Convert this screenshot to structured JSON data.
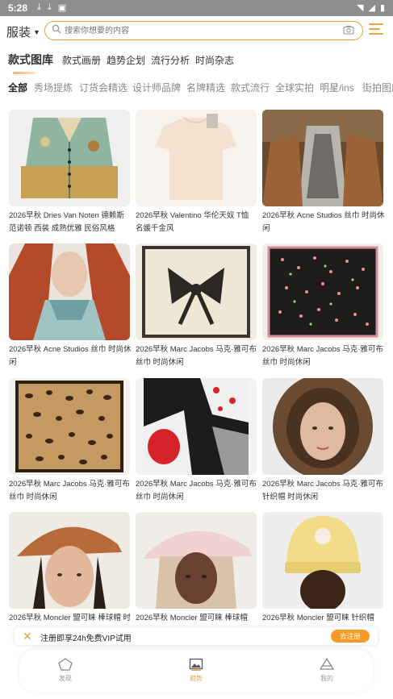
{
  "status_bar": {
    "time": "5:28"
  },
  "search": {
    "category": "服装",
    "placeholder": "搜索你想要的内容"
  },
  "top_tabs": [
    {
      "label": "款式图库",
      "active": true
    },
    {
      "label": "款式画册",
      "active": false
    },
    {
      "label": "趋势企划",
      "active": false
    },
    {
      "label": "流行分析",
      "active": false
    },
    {
      "label": "时尚杂志",
      "active": false
    }
  ],
  "filter_tabs": [
    {
      "label": "全部",
      "active": true
    },
    {
      "label": "秀场提炼"
    },
    {
      "label": "订货会精选"
    },
    {
      "label": "设计师品牌"
    },
    {
      "label": "名牌精选"
    },
    {
      "label": "款式流行"
    },
    {
      "label": "全球实拍"
    },
    {
      "label": "明星/ins"
    },
    {
      "label": "街拍图库"
    }
  ],
  "cards": [
    {
      "caption": "2026早秋 Dries Van Noten 德赖斯范诺顿 西装 成熟优雅 民俗风格"
    },
    {
      "caption": "2026早秋 Valentino 华伦天奴 T恤 名媛千金风"
    },
    {
      "caption": "2026早秋 Acne Studios 丝巾 时尚休闲"
    },
    {
      "caption": "2026早秋 Acne Studios 丝巾 时尚休闲"
    },
    {
      "caption": "2026早秋 Marc Jacobs 马克·雅可布 丝巾 时尚休闲"
    },
    {
      "caption": "2026早秋 Marc Jacobs 马克·雅可布 丝巾 时尚休闲"
    },
    {
      "caption": "2026早秋 Marc Jacobs 马克·雅可布 丝巾 时尚休闲"
    },
    {
      "caption": "2026早秋 Marc Jacobs 马克·雅可布 丝巾 时尚休闲"
    },
    {
      "caption": "2026早秋 Marc Jacobs 马克·雅可布 针织帽 时尚休闲"
    },
    {
      "caption": "2026早秋 Moncler 盟可睐 棒球帽 时"
    },
    {
      "caption": "2026早秋 Moncler 盟可睐 棒球帽"
    },
    {
      "caption": "2026早秋 Moncler 盟可睐 针织帽"
    }
  ],
  "vip_banner": {
    "text": "注册即享24h免费VIP试用",
    "button": "去注册"
  },
  "bottom_nav": [
    {
      "label": "发现",
      "icon": "pentagon-icon",
      "active": false
    },
    {
      "label": "趋势",
      "icon": "image-icon",
      "active": true
    },
    {
      "label": "我的",
      "icon": "profile-icon",
      "active": false
    }
  ],
  "colors": {
    "accent": "#f0a040",
    "button": "#f59a2a",
    "statusbar": "#8e8e8e"
  }
}
